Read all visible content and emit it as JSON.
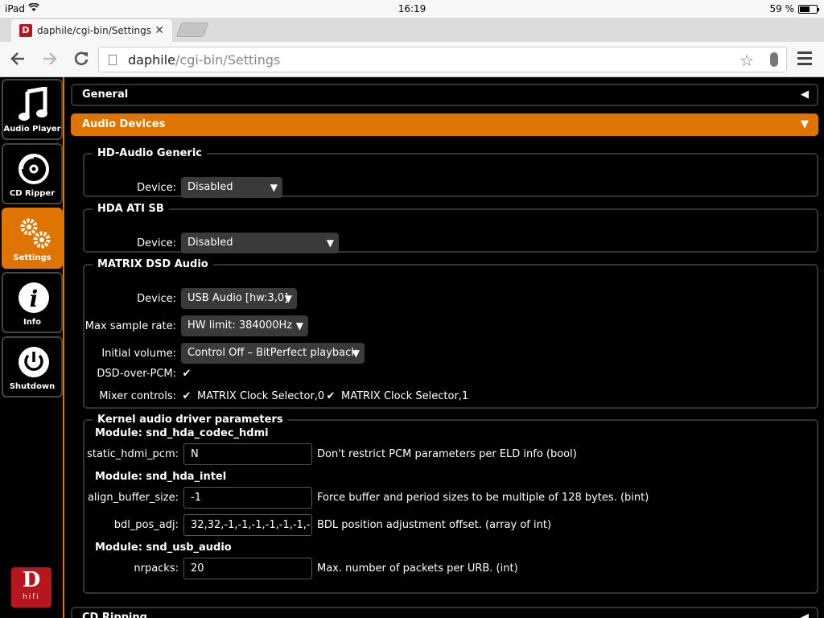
{
  "status_bar": {
    "device": "iPad",
    "time": "16:19",
    "battery": "59 %",
    "battery_level": 0.59
  },
  "browser": {
    "tab_title": "daphile/cgi-bin/Settings",
    "favicon_letter": "D",
    "url_host": "daphile",
    "url_path": "/cgi-bin/Settings"
  },
  "sidebar": {
    "items": [
      {
        "label": "Audio Player",
        "icon": "music-note-icon"
      },
      {
        "label": "CD Ripper",
        "icon": "cd-icon"
      },
      {
        "label": "Settings",
        "icon": "gears-icon"
      },
      {
        "label": "Info",
        "icon": "info-icon"
      },
      {
        "label": "Shutdown",
        "icon": "power-icon"
      }
    ],
    "logo": {
      "big": "D",
      "small": "hifi"
    }
  },
  "sections": {
    "general": "General",
    "audio_devices": "Audio Devices",
    "cd_ripping": "CD Ripping"
  },
  "colors": {
    "accent": "#e07400",
    "logo": "#b8161f"
  },
  "hd_audio_generic": {
    "title": "HD-Audio Generic",
    "device_label": "Device:",
    "device_value": "Disabled"
  },
  "hda_ati_sb": {
    "title": "HDA ATI SB",
    "device_label": "Device:",
    "device_value": "Disabled"
  },
  "matrix": {
    "title": "MATRIX DSD Audio",
    "device_label": "Device:",
    "device_value": "USB Audio [hw:3,0]",
    "rate_label": "Max sample rate:",
    "rate_value": "HW limit: 384000Hz",
    "volume_label": "Initial volume:",
    "volume_value": "Control Off – BitPerfect playback",
    "dop_label": "DSD-over-PCM:",
    "dop_checked": "✔",
    "mixer_label": "Mixer controls:",
    "mixer_items": [
      "MATRIX Clock Selector,0",
      "MATRIX Clock Selector,1"
    ],
    "mixer_checks": [
      "✔",
      "✔"
    ]
  },
  "kernel": {
    "title": "Kernel audio driver parameters",
    "modules": [
      {
        "name": "Module: snd_hda_codec_hdmi",
        "params": [
          {
            "label": "static_hdmi_pcm:",
            "value": "N",
            "desc": "Don't restrict PCM parameters per ELD info (bool)"
          }
        ]
      },
      {
        "name": "Module: snd_hda_intel",
        "params": [
          {
            "label": "align_buffer_size:",
            "value": "-1",
            "desc": "Force buffer and period sizes to be multiple of 128 bytes. (bint)"
          },
          {
            "label": "bdl_pos_adj:",
            "value": "32,32,-1,-1,-1,-1,-1,-1,-",
            "desc": "BDL position adjustment offset. (array of int)"
          }
        ]
      },
      {
        "name": "Module: snd_usb_audio",
        "params": [
          {
            "label": "nrpacks:",
            "value": "20",
            "desc": "Max. number of packets per URB. (int)"
          }
        ]
      }
    ]
  }
}
